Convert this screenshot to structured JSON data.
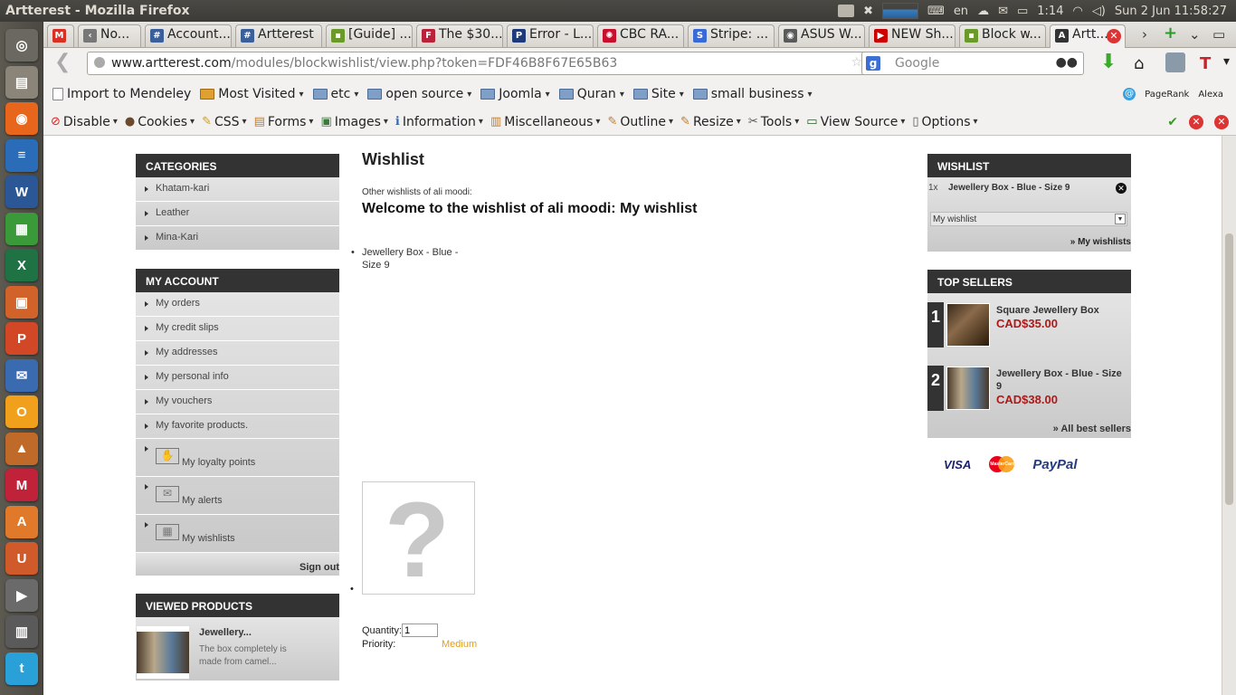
{
  "os": {
    "window_title": "Artterest - Mozilla Firefox",
    "keyboard": "en",
    "battery": "1:14",
    "clock": "Sun 2 Jun  11:58:27"
  },
  "launcher": [
    {
      "name": "dash",
      "color": "#6a6860",
      "glyph": "◎"
    },
    {
      "name": "files",
      "color": "#8a8578",
      "glyph": "▤"
    },
    {
      "name": "firefox",
      "color": "#e8651c",
      "glyph": "◉"
    },
    {
      "name": "writer",
      "color": "#2a6cb8",
      "glyph": "≡"
    },
    {
      "name": "word",
      "color": "#2b5797",
      "glyph": "W"
    },
    {
      "name": "calc",
      "color": "#3a9a3a",
      "glyph": "▦"
    },
    {
      "name": "excel",
      "color": "#1f7244",
      "glyph": "X"
    },
    {
      "name": "impress",
      "color": "#d0622a",
      "glyph": "▣"
    },
    {
      "name": "powerpoint",
      "color": "#d24726",
      "glyph": "P"
    },
    {
      "name": "thunderbird",
      "color": "#3a6ab0",
      "glyph": "✉"
    },
    {
      "name": "outlook",
      "color": "#f0a01a",
      "glyph": "O"
    },
    {
      "name": "matlab",
      "color": "#c06a2a",
      "glyph": "▲"
    },
    {
      "name": "mendeley",
      "color": "#c0223a",
      "glyph": "M"
    },
    {
      "name": "software-center",
      "color": "#e07a2a",
      "glyph": "A"
    },
    {
      "name": "ubuntu-one",
      "color": "#d05a2a",
      "glyph": "U"
    },
    {
      "name": "youtube",
      "color": "#6a6a6a",
      "glyph": "▶"
    },
    {
      "name": "workspaces",
      "color": "#5a5a5a",
      "glyph": "▥"
    },
    {
      "name": "twitter",
      "color": "#2aa0d8",
      "glyph": "t"
    }
  ],
  "tabs": [
    {
      "label": "",
      "color": "#d93025",
      "glyph": "M",
      "width": 30
    },
    {
      "label": "No...",
      "color": "#777",
      "glyph": "‹",
      "width": 70
    },
    {
      "label": "Account...",
      "color": "#3a5f9a",
      "glyph": "#",
      "width": 96
    },
    {
      "label": "Artterest",
      "color": "#3a5f9a",
      "glyph": "#",
      "width": 96
    },
    {
      "label": "[Guide] ...",
      "color": "#6a9a2a",
      "glyph": "▪",
      "width": 96
    },
    {
      "label": "The $30...",
      "color": "#b8233a",
      "glyph": "F",
      "width": 96
    },
    {
      "label": "Error - L...",
      "color": "#1f3a7a",
      "glyph": "P",
      "width": 96
    },
    {
      "label": "CBC RA...",
      "color": "#c8102e",
      "glyph": "✺",
      "width": 96
    },
    {
      "label": "Stripe: ...",
      "color": "#3a6ad6",
      "glyph": "S",
      "width": 96
    },
    {
      "label": "ASUS W...",
      "color": "#5a5a5a",
      "glyph": "◉",
      "width": 96
    },
    {
      "label": "NEW Sh...",
      "color": "#cc0000",
      "glyph": "▶",
      "width": 96
    },
    {
      "label": "Block w...",
      "color": "#6a9a2a",
      "glyph": "▪",
      "width": 96
    },
    {
      "label": "Artt...",
      "color": "#333",
      "glyph": "A",
      "width": 84,
      "active": true
    }
  ],
  "nav": {
    "url_host": "www.artterest.com",
    "url_path": "/modules/blockwishlist/view.php?token=FDF46B8F67E65B63",
    "search_placeholder": "Google"
  },
  "bookmarks": [
    {
      "label": "Import to Mendeley",
      "icon": "page-icon",
      "caret": false
    },
    {
      "label": "Most Visited",
      "icon": "star-folder-icon",
      "caret": true
    },
    {
      "label": "etc",
      "icon": "folder-icon",
      "caret": true
    },
    {
      "label": "open source",
      "icon": "folder-icon",
      "caret": true
    },
    {
      "label": "Joomla",
      "icon": "folder-icon",
      "caret": true
    },
    {
      "label": "Quran",
      "icon": "folder-icon",
      "caret": true
    },
    {
      "label": "Site",
      "icon": "folder-icon",
      "caret": true
    },
    {
      "label": "small business",
      "icon": "folder-icon",
      "caret": true
    }
  ],
  "bookmarks_right": [
    "PageRank",
    "Alexa"
  ],
  "webdev": [
    {
      "label": "Disable",
      "glyph": "⊘",
      "color": "#d22"
    },
    {
      "label": "Cookies",
      "glyph": "●",
      "color": "#6a4a2a"
    },
    {
      "label": "CSS",
      "glyph": "✎",
      "color": "#c8a020"
    },
    {
      "label": "Forms",
      "glyph": "▤",
      "color": "#c87a20"
    },
    {
      "label": "Images",
      "glyph": "▣",
      "color": "#3a7a3a"
    },
    {
      "label": "Information",
      "glyph": "ℹ",
      "color": "#2a6ac0"
    },
    {
      "label": "Miscellaneous",
      "glyph": "▥",
      "color": "#c87a20"
    },
    {
      "label": "Outline",
      "glyph": "✎",
      "color": "#c87a20"
    },
    {
      "label": "Resize",
      "glyph": "✎",
      "color": "#c87a20"
    },
    {
      "label": "Tools",
      "glyph": "✂",
      "color": "#555"
    },
    {
      "label": "View Source",
      "glyph": "▭",
      "color": "#2a5a2a"
    },
    {
      "label": "Options",
      "glyph": "▯",
      "color": "#555"
    }
  ],
  "left": {
    "categories": {
      "title": "Categories",
      "items": [
        "Khatam-kari",
        "Leather",
        "Mina-Kari"
      ]
    },
    "account": {
      "title": "My account",
      "items": [
        "My orders",
        "My credit slips",
        "My addresses",
        "My personal info",
        "My vouchers",
        "My favorite products."
      ],
      "icon_items": [
        {
          "label": "My loyalty points",
          "icon": "handshake-icon",
          "glyph": "✋"
        },
        {
          "label": "My alerts",
          "icon": "envelope-icon",
          "glyph": "✉"
        },
        {
          "label": "My wishlists",
          "icon": "gift-icon",
          "glyph": "▦"
        }
      ],
      "signout": "Sign out"
    },
    "viewed": {
      "title": "Viewed products",
      "name": "Jewellery...",
      "desc": "The box completely is made from camel..."
    }
  },
  "center": {
    "title": "Wishlist",
    "other_lists": "Other wishlists of ali moodi:",
    "welcome": "Welcome to the wishlist of ali moodi: My wishlist",
    "product": "Jewellery Box - Blue - Size 9",
    "quantity_label": "Quantity:",
    "quantity_value": "1",
    "priority_label": "Priority:",
    "priority_value": "Medium"
  },
  "right": {
    "wishlist": {
      "title": "Wishlist",
      "qty": "1x",
      "item": "Jewellery Box - Blue - Size 9",
      "select": "My wishlist",
      "link": "» My wishlists"
    },
    "topsellers": {
      "title": "Top sellers",
      "items": [
        {
          "rank": "1",
          "name": "Square Jewellery Box",
          "price": "CAD$35.00"
        },
        {
          "rank": "2",
          "name": "Jewellery Box - Blue - Size 9",
          "price": "CAD$38.00"
        }
      ],
      "link": "» All best sellers"
    },
    "payments": [
      "VISA",
      "MasterCard",
      "PayPal"
    ]
  }
}
